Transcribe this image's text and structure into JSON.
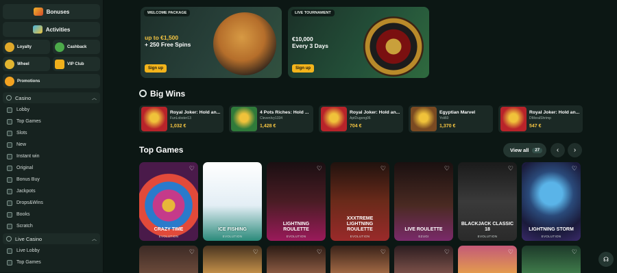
{
  "sidebar": {
    "bonuses_label": "Bonuses",
    "activities_label": "Activities",
    "tiles": [
      {
        "label": "Loyalty",
        "icon": "loyalty-icon",
        "color": "#e0a92a"
      },
      {
        "label": "Cashback",
        "icon": "cashback-icon",
        "color": "#4caa4a"
      },
      {
        "label": "Wheel",
        "icon": "wheel-icon",
        "color": "#e2b530"
      },
      {
        "label": "VIP Club",
        "icon": "crown-icon",
        "color": "#f0b01c"
      }
    ],
    "promotions_label": "Promotions",
    "casino_section": "Casino",
    "casino_items": [
      "Lobby",
      "Top Games",
      "Slots",
      "New",
      "Instant win",
      "Original",
      "Bonus Buy",
      "Jackpots",
      "Drops&Wins",
      "Books",
      "Scratch"
    ],
    "live_section": "Live Casino",
    "live_items": [
      "Live Lobby",
      "Top Games"
    ]
  },
  "promos": [
    {
      "tag": "WELCOME PACKAGE",
      "line1": "up to €1,500",
      "line2": "+ 250 Free Spins",
      "button": "Sign up"
    },
    {
      "tag": "LIVE TOURNAMENT",
      "line1": "€10,000",
      "line2": "Every 3 Days",
      "button": "Sign up"
    }
  ],
  "big_wins": {
    "title": "Big Wins",
    "items": [
      {
        "game": "Royal Joker: Hold an...",
        "user": "FunLobster13",
        "amount": "1,032 €"
      },
      {
        "game": "4 Pots Riches: Hold ...",
        "user": "ClevenIvy1334",
        "amount": "1,428 €"
      },
      {
        "game": "Royal Joker: Hold an...",
        "user": "AptDugong06",
        "amount": "704 €"
      },
      {
        "game": "Egyptian Marvel",
        "user": "Yoli60",
        "amount": "1,370 €"
      },
      {
        "game": "Royal Joker: Hold an...",
        "user": "DMoralShrimp",
        "amount": "547 €"
      }
    ]
  },
  "top_games": {
    "title": "Top Games",
    "view_all": "View all",
    "count": "27",
    "items": [
      {
        "name": "CRAZY TIME",
        "provider": "EVOLUTION"
      },
      {
        "name": "ICE FISHING",
        "provider": "EVOLUTION"
      },
      {
        "name": "LIGHTNING ROULETTE",
        "provider": "EVOLUTION"
      },
      {
        "name": "XXXTREME LIGHTNING ROULETTE",
        "provider": "EVOLUTION"
      },
      {
        "name": "LIVE ROULETTE",
        "provider": "EZUGI"
      },
      {
        "name": "BLACKJACK CLASSIC 18",
        "provider": "EVOLUTION"
      },
      {
        "name": "LIGHTNING STORM",
        "provider": "EVOLUTION"
      }
    ]
  }
}
